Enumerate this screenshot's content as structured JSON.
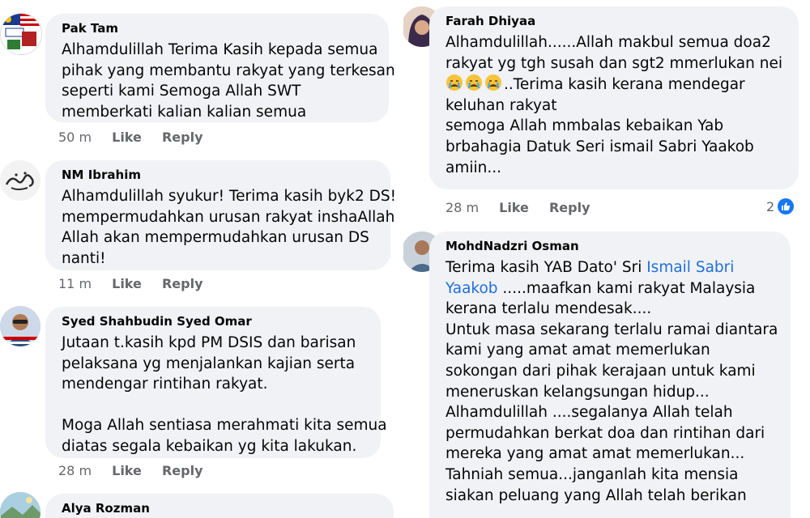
{
  "comments_left": [
    {
      "author": "Pak Tam",
      "lines": [
        "Alhamdulillah Terima Kasih kepada semua",
        "pihak yang membantu rakyat yang terkesan",
        "seperti kami Semoga Allah SWT",
        "memberkati  kalian kalian semua"
      ],
      "time": "50 m",
      "like": "Like",
      "reply": "Reply"
    },
    {
      "author": "NM Ibrahim",
      "lines": [
        "Alhamdulillah syukur! Terima kasih byk2 DS!",
        "mempermudahkan urusan rakyat inshaAllah",
        "Allah akan mempermudahkan urusan DS",
        "nanti!"
      ],
      "time": "11 m",
      "like": "Like",
      "reply": "Reply"
    },
    {
      "author": "Syed Shahbudin Syed Omar",
      "lines": [
        "Jutaan t.kasih kpd PM DSIS dan barisan",
        "pelaksana yg menjalankan kajian serta",
        "mendengar rintihan rakyat.",
        "",
        "Moga Allah sentiasa merahmati kita semua",
        "diatas segala kebaikan yg kita lakukan."
      ],
      "time": "28 m",
      "like": "Like",
      "reply": "Reply"
    },
    {
      "author": "Alya Rozman"
    }
  ],
  "comments_right": [
    {
      "author": "Farah Dhiyaa",
      "line1": "Alhamdulillah......Allah makbul semua doa2",
      "line2": "rakyat yg tgh susah dan sgt2 mmerlukan nei",
      "line3_text": "..Terima kasih kerana mendegar",
      "lines_rest": [
        "keluhan rakyat",
        "semoga Allah mmbalas kebaikan Yab",
        "brbahagia Datuk Seri ismail Sabri Yaakob",
        "amiin..."
      ],
      "time": "28 m",
      "like": "Like",
      "reply": "Reply",
      "reaction_count": "2"
    },
    {
      "author": "MohdNadzri Osman",
      "line1_prefix": "Terima kasih YAB Dato' Sri ",
      "line1_link": "Ismail Sabri",
      "line2_link": "Yaakob",
      "line2_suffix": " .....maafkan kami rakyat Malaysia",
      "lines_rest": [
        "kerana terlalu mendesak....",
        "Untuk masa sekarang terlalu ramai diantara",
        "kami yang amat amat memerlukan",
        "sokongan dari pihak kerajaan untuk kami",
        "meneruskan kelangsungan hidup...",
        "Alhamdulillah ....segalanya Allah telah",
        "permudahkan berkat doa dan rintihan dari",
        "mereka yang amat amat memerlukan...",
        "Tahniah semua...janganlah kita mensia",
        "siakan peluang yang Allah telah berikan"
      ]
    }
  ],
  "colors": {
    "bubble": "#f0f2f5",
    "link": "#216fdb",
    "meta": "#65676b",
    "like_badge": "#1877f2"
  },
  "icons": {
    "reaction": "like-thumb-icon",
    "emoji": "crying-face-icon"
  }
}
